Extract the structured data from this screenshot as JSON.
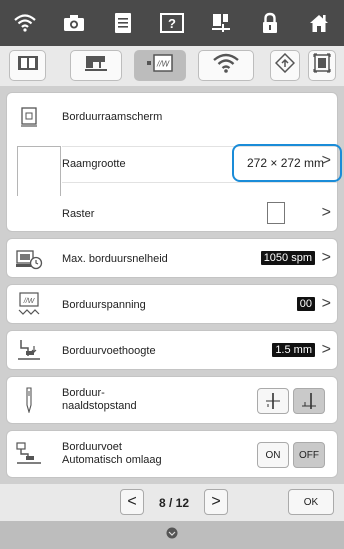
{
  "topbar": {
    "icons": [
      "wifi-icon",
      "camera-icon",
      "document-icon",
      "help-icon",
      "embroidery-foot-icon",
      "lock-icon",
      "home-icon"
    ]
  },
  "tabs": {
    "icons": [
      "book-icon",
      "sewing-machine-icon",
      "embroidery-unit-icon",
      "wifi-icon",
      "settings-diamond-icon",
      "frame-select-icon"
    ]
  },
  "embroidery_frame_display": {
    "label": "Borduurraamscherm"
  },
  "frame_size": {
    "label": "Raamgrootte",
    "value": "272 × 272 mm",
    "highlight_color": "#1a8cd8"
  },
  "grid": {
    "label": "Raster"
  },
  "max_speed": {
    "label": "Max. borduursnelheid",
    "value": "1050 spm"
  },
  "tension": {
    "label": "Borduurspanning",
    "value": "00"
  },
  "foot_height": {
    "label": "Borduurvoethoogte",
    "value": "1.5 mm"
  },
  "needle_stop": {
    "label_line1": "Borduur-",
    "label_line2": "naaldstopstand"
  },
  "foot_auto": {
    "label_line1": "Borduurvoet",
    "label_line2": "Automatisch omlaag",
    "on": "ON",
    "off": "OFF",
    "selected": "OFF"
  },
  "pager": {
    "page_text": "8 / 12",
    "ok": "OK"
  }
}
